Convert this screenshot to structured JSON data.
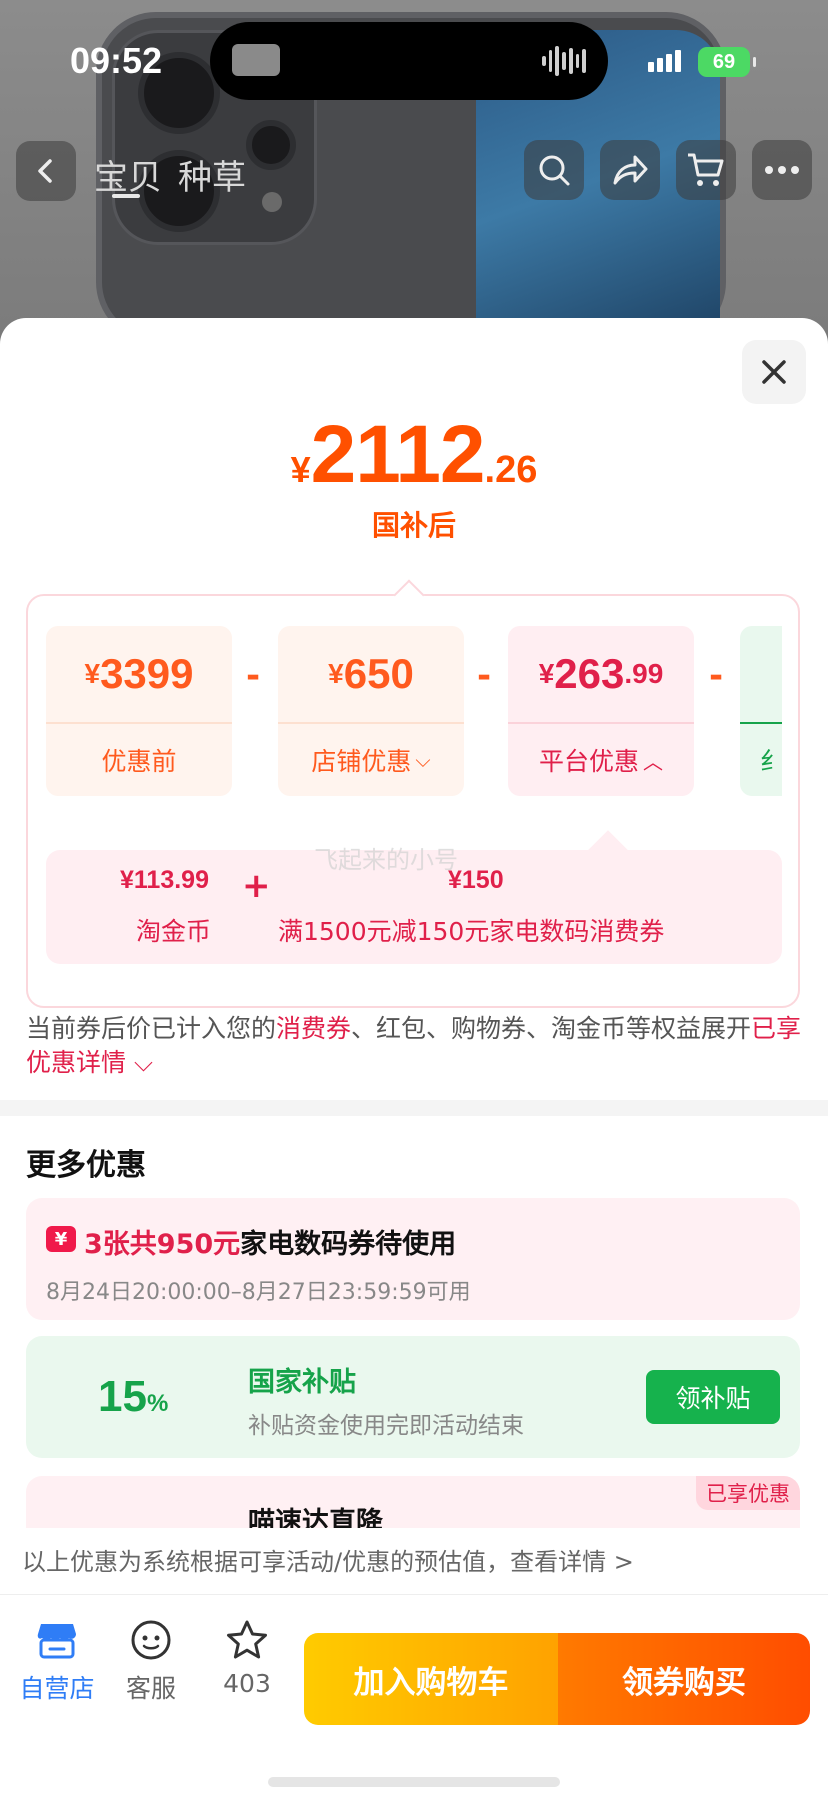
{
  "status_bar": {
    "time": "09:52",
    "battery": "69"
  },
  "nav": {
    "tabs": [
      "宝贝",
      "种草"
    ],
    "icons": [
      "back-icon",
      "search-icon",
      "share-icon",
      "cart-icon",
      "more-icon"
    ]
  },
  "sheet": {
    "price": {
      "currency": "¥",
      "integer": "2112",
      "decimal": ".26",
      "label": "国补后"
    },
    "breakdown": {
      "items": [
        {
          "currency": "¥",
          "amount": "3399",
          "decimal": "",
          "label": "优惠前",
          "chevron": ""
        },
        {
          "currency": "¥",
          "amount": "650",
          "decimal": "",
          "label": "店铺优惠",
          "chevron": "⌵"
        },
        {
          "currency": "¥",
          "amount": "263",
          "decimal": ".99",
          "label": "平台优惠",
          "chevron": "︿"
        },
        {
          "currency": "¥",
          "amount": "",
          "decimal": "",
          "label": "纟",
          "chevron": ""
        }
      ],
      "operator": "-",
      "platform_detail": [
        {
          "value": "¥113.99",
          "label": "淘金币"
        },
        {
          "value": "¥150",
          "label": "满1500元减150元家电数码消费券"
        }
      ],
      "plus": "+",
      "watermark": "飞起来的小号"
    },
    "note": {
      "part1": "当前券后价已计入您的",
      "highlight1": "消费券",
      "part2": "、红包、购物券、淘金币等权益展开",
      "highlight2": "已享优惠详情 ⌵"
    },
    "more_title": "更多优惠",
    "coupon": {
      "icon": "¥",
      "count_text": "3张共950元",
      "title_rest": "家电数码券待使用",
      "time": "8月24日20:00:00–8月27日23:59:59可用"
    },
    "subsidy": {
      "percent": "15",
      "percent_sign": "%",
      "title": "国家补贴",
      "desc": "补贴资金使用完即活动结束",
      "button": "领补贴"
    },
    "partial_offer": {
      "title": "喵速达直降",
      "badge": "已享优惠"
    },
    "disclaimer": "以上优惠为系统根据可享活动/优惠的预估值，查看详情 >"
  },
  "bottom_bar": {
    "shop": "自营店",
    "service": "客服",
    "favorites": "403",
    "add_to_cart": "加入购物车",
    "buy_with_coupon": "领券购买"
  },
  "colors": {
    "accent": "#ff5000",
    "platform_red": "#e0204a",
    "subsidy_green": "#16a34a",
    "shop_blue": "#2f7df6"
  }
}
